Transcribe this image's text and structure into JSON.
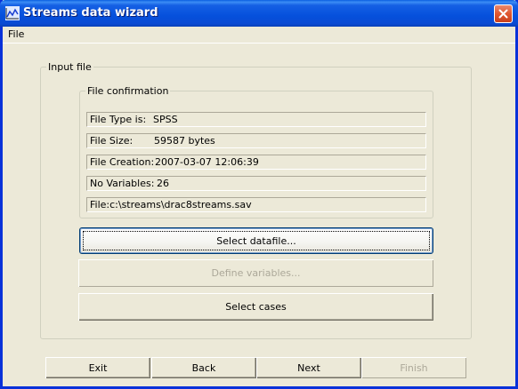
{
  "window": {
    "title": "Streams data wizard",
    "icon": "chart-app-icon"
  },
  "menu": {
    "items": [
      "File"
    ]
  },
  "input_file": {
    "group_label": "Input file",
    "confirmation": {
      "group_label": "File confirmation",
      "rows": [
        {
          "label": "File Type is:",
          "value": "SPSS"
        },
        {
          "label": "File Size:",
          "value": "59587 bytes"
        },
        {
          "label": "File Creation:",
          "value": "2007-03-07 12:06:39"
        },
        {
          "label": "No Variables:",
          "value": "26"
        },
        {
          "label": "File:c:\\streams\\drac8streams.sav",
          "value": ""
        }
      ]
    },
    "buttons": {
      "select_datafile": "Select datafile...",
      "define_variables": "Define variables...",
      "select_cases": "Select cases"
    }
  },
  "nav": {
    "exit": "Exit",
    "back": "Back",
    "next": "Next",
    "finish": "Finish"
  }
}
